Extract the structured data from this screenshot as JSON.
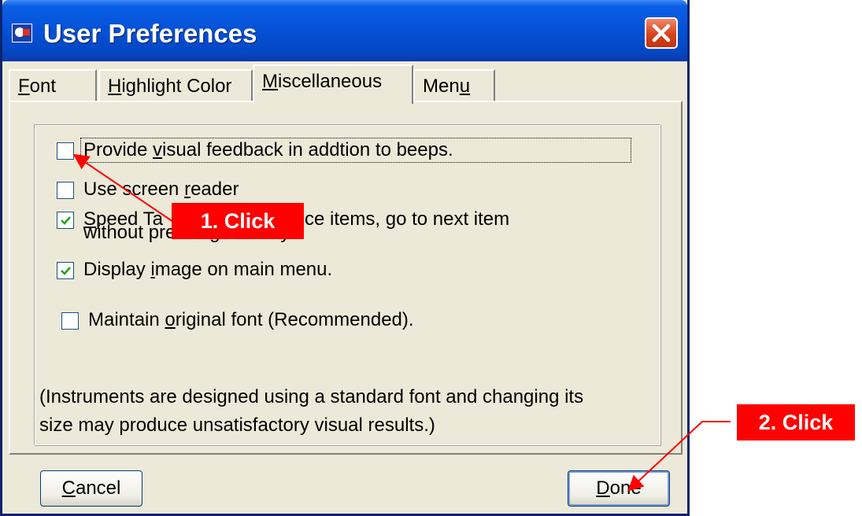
{
  "window": {
    "title": "User Preferences"
  },
  "tabs": [
    {
      "label_ul": "F",
      "label_rest": "ont"
    },
    {
      "label_ul": "H",
      "label_rest": "ighlight Color"
    },
    {
      "label_ul": "M",
      "label_rest": "iscellaneous",
      "active": true
    },
    {
      "label_pre": "Men",
      "label_ul": "u"
    }
  ],
  "options": {
    "visual_feedback": {
      "pre": "Provide ",
      "ul": "v",
      "post": "isual feedback in addtion to beeps.",
      "checked": false
    },
    "screen_reader": {
      "pre": "Use screen ",
      "ul": "r",
      "post": "eader",
      "checked": false
    },
    "speed_tab": {
      "ul": "S",
      "line1_post": "peed Ta",
      "line1_rest": "choice items, go to next item",
      "line2": "without pressing Tab key.",
      "checked": true
    },
    "display_image": {
      "pre": "Display ",
      "ul": "i",
      "post": "mage on main menu.",
      "checked": true
    },
    "maintain_font": {
      "pre": "Maintain ",
      "ul": "o",
      "post": "riginal font (Recommended).",
      "checked": false
    }
  },
  "note": {
    "line1": "(Instruments are designed using a standard font and changing its",
    "line2": "size may produce unsatisfactory visual results.)"
  },
  "buttons": {
    "cancel": {
      "ul": "C",
      "rest": "ancel"
    },
    "done": {
      "ul": "D",
      "rest": "one"
    }
  },
  "annotations": {
    "step1": "1. Click",
    "step2": "2. Click",
    "color": "#ff0000"
  }
}
